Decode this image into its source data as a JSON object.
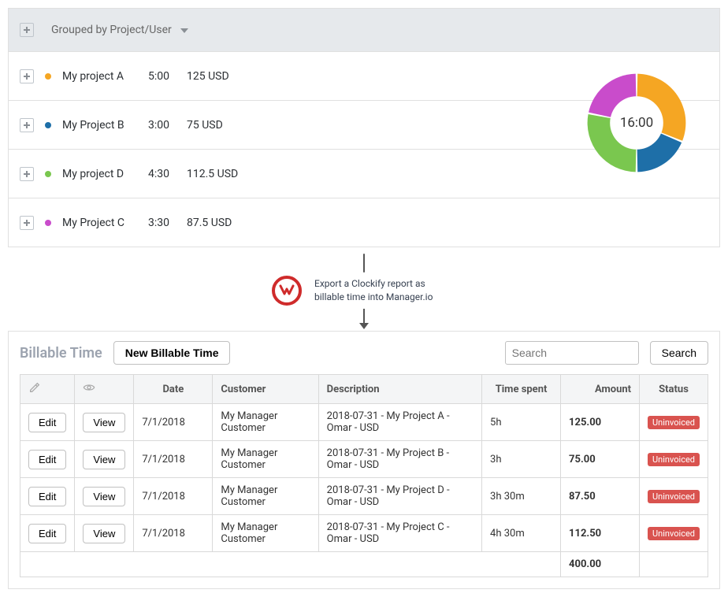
{
  "clockify": {
    "group_label": "Grouped by Project/User",
    "total_time": "16:00",
    "projects": [
      {
        "name": "My project A",
        "hours": "5:00",
        "amount": "125 USD",
        "color": "#f5a623"
      },
      {
        "name": "My Project B",
        "hours": "3:00",
        "amount": "75 USD",
        "color": "#1e6fa8"
      },
      {
        "name": "My project D",
        "hours": "4:30",
        "amount": "112.5 USD",
        "color": "#7ac74f"
      },
      {
        "name": "My Project C",
        "hours": "3:30",
        "amount": "87.5 USD",
        "color": "#c94ccb"
      }
    ]
  },
  "flow_caption": "Export a Clockify report as billable time into Manager.io",
  "manager": {
    "title": "Billable Time",
    "new_button": "New Billable Time",
    "search_placeholder": "Search",
    "search_button": "Search",
    "edit_button": "Edit",
    "view_button": "View",
    "columns": {
      "date": "Date",
      "customer": "Customer",
      "description": "Description",
      "time_spent": "Time spent",
      "amount": "Amount",
      "status": "Status"
    },
    "rows": [
      {
        "date": "7/1/2018",
        "customer": "My Manager Customer",
        "description": "2018-07-31 - My Project A - Omar - USD",
        "time_spent": "5h",
        "amount": "125.00",
        "status": "Uninvoiced"
      },
      {
        "date": "7/1/2018",
        "customer": "My Manager Customer",
        "description": "2018-07-31 - My Project B - Omar - USD",
        "time_spent": "3h",
        "amount": "75.00",
        "status": "Uninvoiced"
      },
      {
        "date": "7/1/2018",
        "customer": "My Manager Customer",
        "description": "2018-07-31 - My Project D - Omar - USD",
        "time_spent": "3h 30m",
        "amount": "87.50",
        "status": "Uninvoiced"
      },
      {
        "date": "7/1/2018",
        "customer": "My Manager Customer",
        "description": "2018-07-31 - My Project C - Omar - USD",
        "time_spent": "4h 30m",
        "amount": "112.50",
        "status": "Uninvoiced"
      }
    ],
    "total": "400.00"
  },
  "chart_data": {
    "type": "pie",
    "title": "",
    "center_label": "16:00",
    "categories": [
      "My project A",
      "My Project B",
      "My project D",
      "My Project C"
    ],
    "values_hours": [
      5.0,
      3.0,
      4.5,
      3.5
    ],
    "colors": [
      "#f5a623",
      "#1e6fa8",
      "#7ac74f",
      "#c94ccb"
    ]
  }
}
